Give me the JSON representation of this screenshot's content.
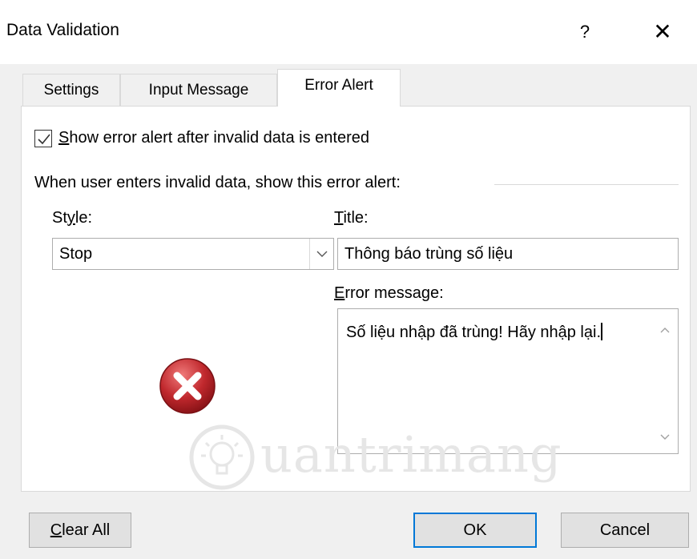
{
  "window": {
    "title": "Data Validation",
    "help_label": "?",
    "close_label": "✕"
  },
  "tabs": [
    {
      "label": "Settings",
      "active": false
    },
    {
      "label": "Input Message",
      "active": false
    },
    {
      "label": "Error Alert",
      "active": true
    }
  ],
  "checkbox": {
    "checked": true,
    "label_first": "S",
    "label_rest": "how error alert after invalid data is entered"
  },
  "group_label": "When user enters invalid data, show this error alert:",
  "style": {
    "label_pre": "St",
    "label_u": "y",
    "label_post": "le:",
    "value": "Stop"
  },
  "title_field": {
    "label_u": "T",
    "label_rest": "itle:",
    "value": "Thông báo trùng số liệu"
  },
  "error_message": {
    "label_u": "E",
    "label_rest": "rror message:",
    "value": "Số liệu nhập đã trùng! Hãy nhập lại."
  },
  "watermark": "uantrimang",
  "buttons": {
    "clear_first": "C",
    "clear_rest": "lear All",
    "ok": "OK",
    "cancel": "Cancel"
  },
  "colors": {
    "accent": "#0078d7",
    "stop_icon": "#c0282d"
  },
  "icons": [
    "help-icon",
    "close-icon",
    "checkmark-icon",
    "chevron-down-icon",
    "stop-error-icon",
    "scroll-up-icon",
    "scroll-down-icon",
    "lightbulb-logo-icon"
  ]
}
